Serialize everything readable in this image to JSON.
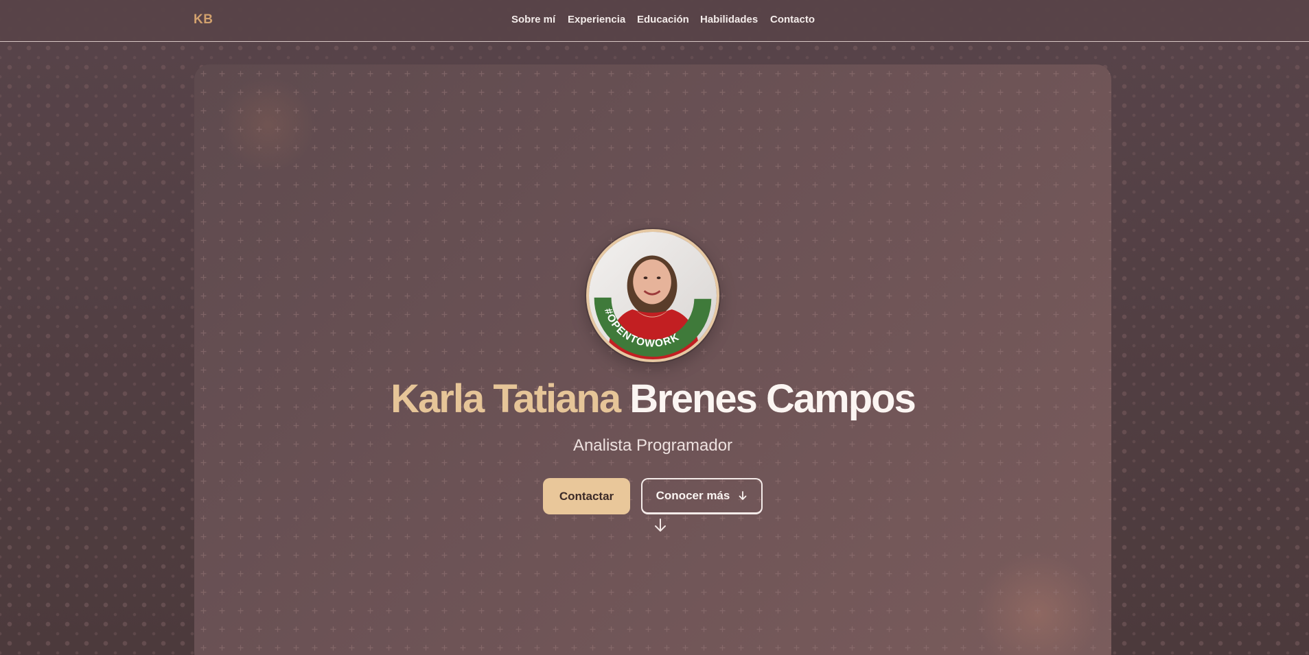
{
  "header": {
    "logo": "KB",
    "nav": [
      {
        "label": "Sobre mí"
      },
      {
        "label": "Experiencia"
      },
      {
        "label": "Educación"
      },
      {
        "label": "Habilidades"
      },
      {
        "label": "Contacto"
      }
    ]
  },
  "hero": {
    "avatar_badge": "#OPENTOWORK",
    "name_first": "Karla Tatiana",
    "name_last": "Brenes Campos",
    "subtitle": "Analista Programador",
    "primary_button": "Contactar",
    "secondary_button": "Conocer más",
    "secondary_icon": "arrow-down-icon",
    "scroll_icon": "arrow-down-icon"
  },
  "colors": {
    "accent": "#e9c79a",
    "background": "#503d3f",
    "card": "#6b5255",
    "text": "#fbf5f2"
  }
}
